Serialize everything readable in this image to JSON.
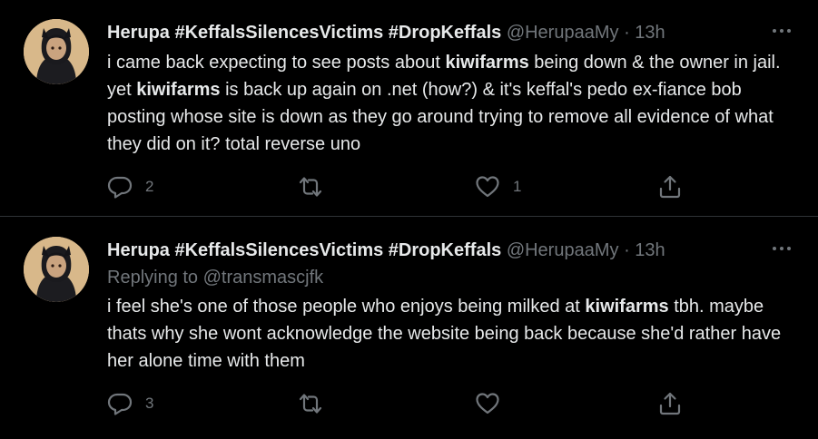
{
  "tweets": [
    {
      "display_name": "Herupa #KeffalsSilencesVictims #DropKeffals",
      "handle": "@HerupaaMy",
      "separator": "·",
      "time": "13h",
      "more_label": "···",
      "replying_prefix": "",
      "replying_mention": "",
      "text_parts": [
        "i came back expecting to see posts about ",
        "kiwifarms",
        " being down & the owner in jail. yet ",
        "kiwifarms",
        " is back up again on .net (how?) & it's keffal's pedo ex-fiance bob posting whose site is down as they go around trying to remove all evidence of what they did on it? total reverse uno"
      ],
      "reply_count": "2",
      "retweet_count": "",
      "like_count": "1"
    },
    {
      "display_name": "Herupa #KeffalsSilencesVictims #DropKeffals",
      "handle": "@HerupaaMy",
      "separator": "·",
      "time": "13h",
      "more_label": "···",
      "replying_prefix": "Replying to ",
      "replying_mention": "@transmascjfk",
      "text_parts": [
        "i feel she's one of those people who enjoys being milked at ",
        "kiwifarms",
        " tbh. maybe thats why she wont acknowledge the website being back because she'd rather have her alone time with them"
      ],
      "reply_count": "3",
      "retweet_count": "",
      "like_count": ""
    }
  ],
  "colors": {
    "background": "#000000",
    "text": "#e7e9ea",
    "secondary": "#71767b",
    "divider": "#2f3336"
  },
  "icons": {
    "reply": "reply-icon",
    "retweet": "retweet-icon",
    "like": "heart-icon",
    "share": "share-icon",
    "more": "more-icon"
  }
}
